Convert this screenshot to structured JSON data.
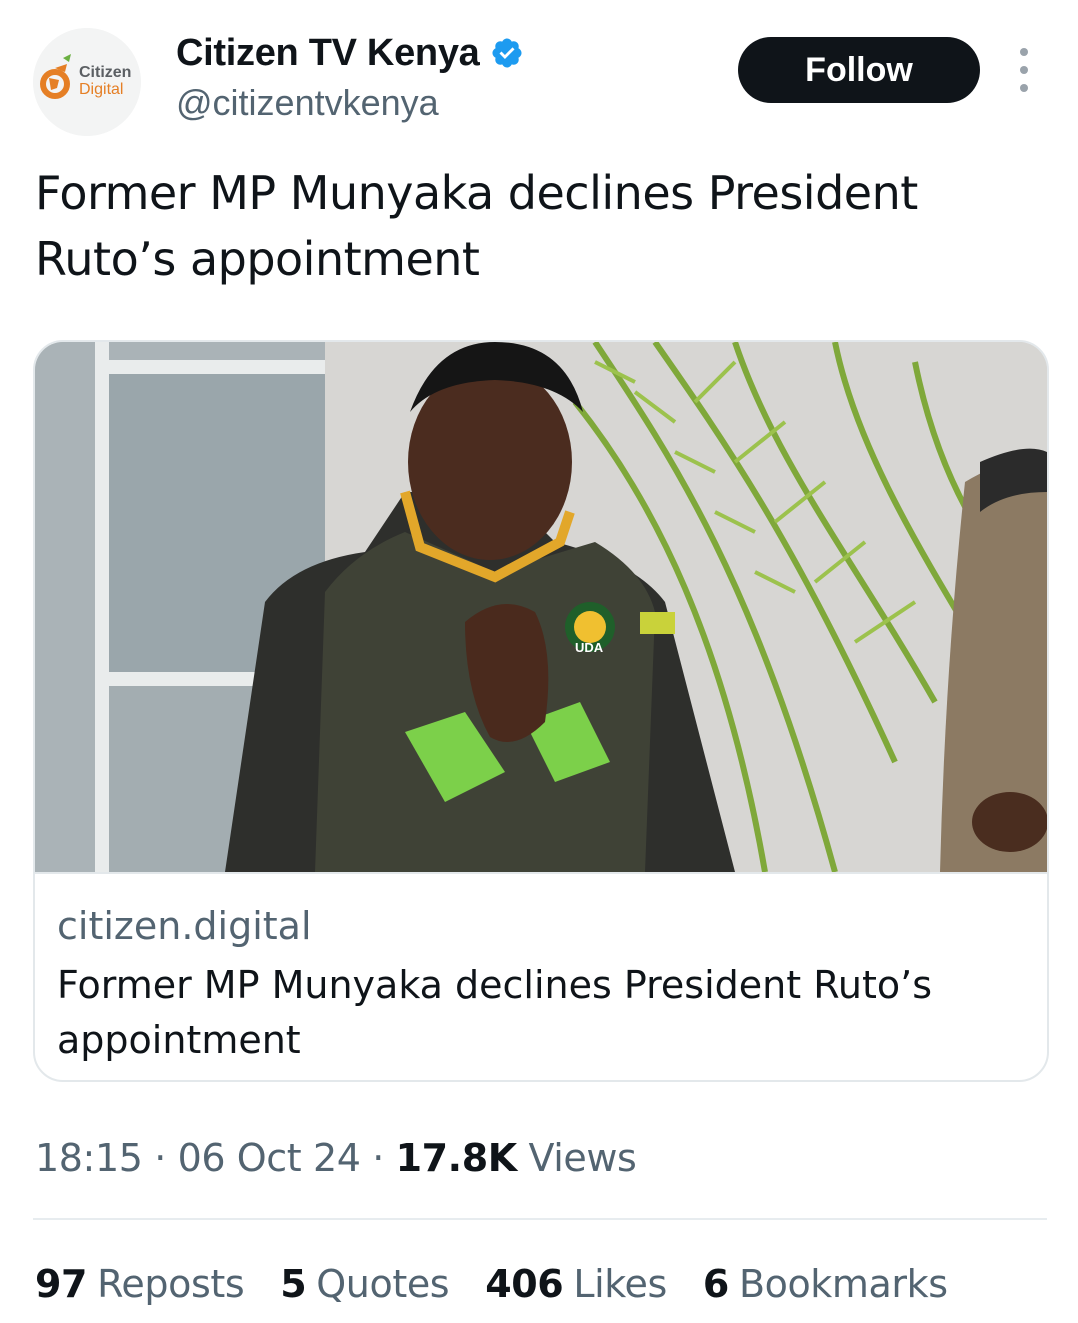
{
  "account": {
    "display_name": "Citizen TV Kenya",
    "handle": "@citizentvkenya",
    "verified_icon": "verified-badge-icon",
    "avatar": {
      "brand_line1": "Citizen",
      "brand_line2": "Digital"
    }
  },
  "actions": {
    "follow_label": "Follow",
    "more_icon": "more-options-icon"
  },
  "tweet": {
    "text": "Former MP Munyaka declines President Ruto’s appointment"
  },
  "card": {
    "image_badge": "UDA",
    "domain": "citizen.digital",
    "title": "Former MP Munyaka declines President Ruto’s appointment"
  },
  "meta": {
    "time": "18:15",
    "separator": " · ",
    "date": "06 Oct 24",
    "views_count": "17.8K",
    "views_label": "Views"
  },
  "stats": [
    {
      "count": "97",
      "label": "Reposts"
    },
    {
      "count": "5",
      "label": "Quotes"
    },
    {
      "count": "406",
      "label": "Likes"
    },
    {
      "count": "6",
      "label": "Bookmarks"
    }
  ],
  "colors": {
    "text_primary": "#0f1419",
    "text_secondary": "#536471",
    "verified_blue": "#1d9bf0",
    "border": "#e3e8eb",
    "brand_orange": "#e57f25"
  }
}
